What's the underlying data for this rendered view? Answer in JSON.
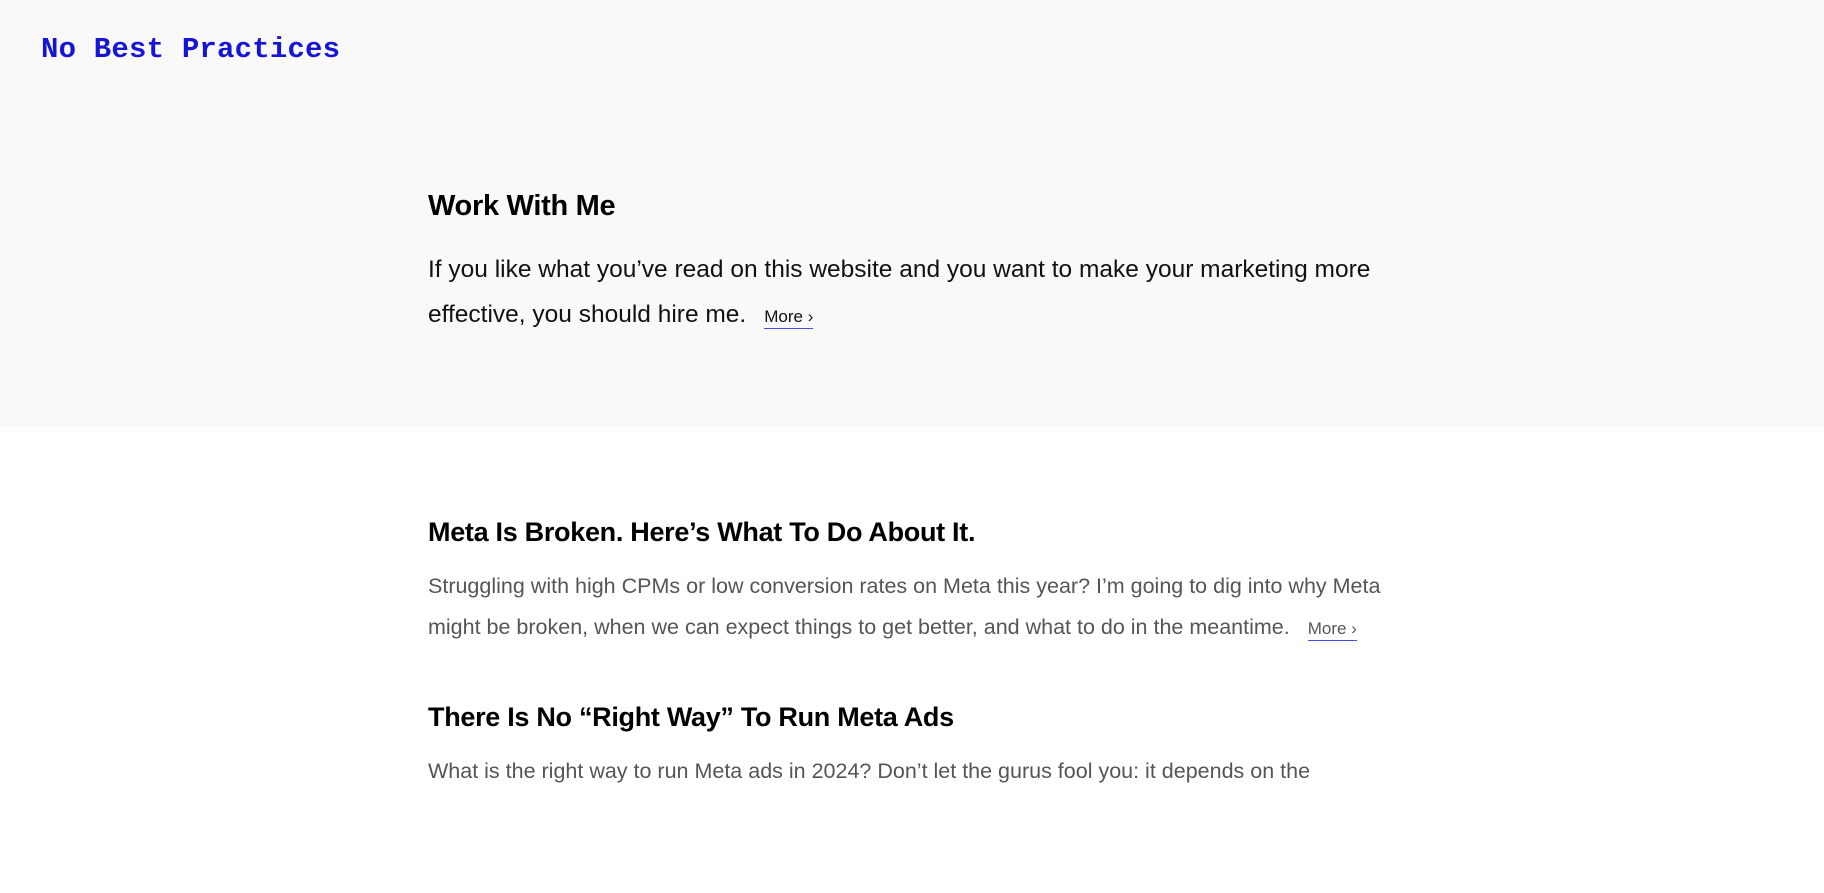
{
  "header": {
    "site_title": "No Best Practices"
  },
  "hero": {
    "title": "Work With Me",
    "text": "If you like what you’ve read on this website and you want to make your marketing more effective, you should hire me.",
    "more_label": "More ›"
  },
  "posts": [
    {
      "title": "Meta Is Broken. Here’s What To Do About It.",
      "excerpt": "Struggling with high CPMs or low conversion rates on Meta this year? I’m going to dig into why Meta might be broken, when we can expect things to get better, and what to do in the meantime.",
      "more_label": "More ›"
    },
    {
      "title": "There Is No “Right Way” To Run Meta Ads",
      "excerpt": "What is the right way to run Meta ads in 2024? Don’t let the gurus fool you: it depends on the"
    }
  ],
  "colors": {
    "site_title": "#1515d6",
    "hero_background": "#f9f9f9",
    "link_underline": "#4a4ae0",
    "excerpt_text": "#555555"
  }
}
